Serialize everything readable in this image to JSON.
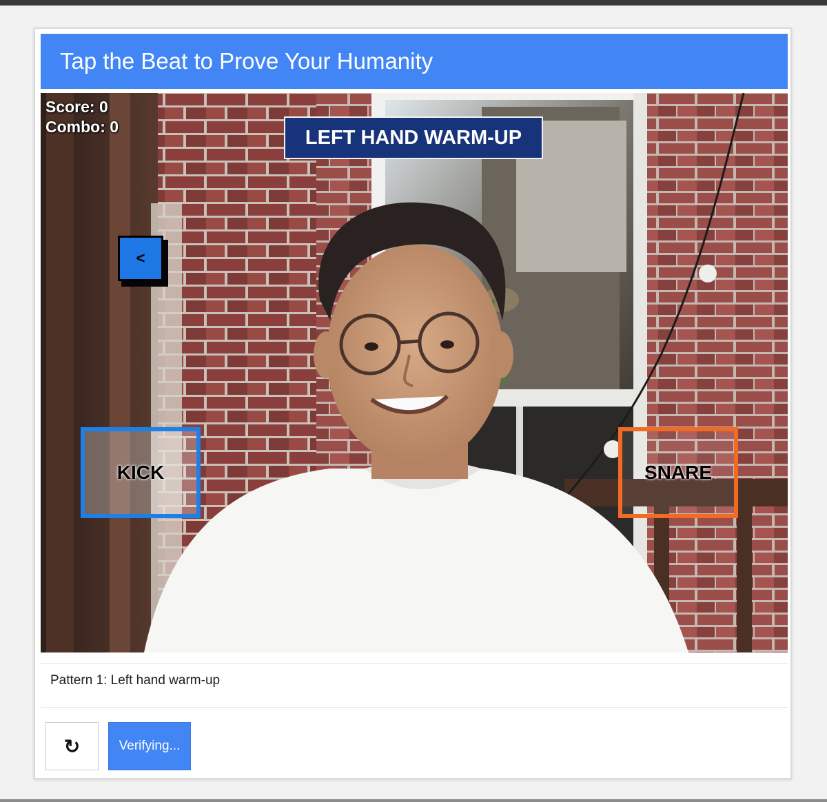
{
  "captcha": {
    "title": "Tap the Beat to Prove Your Humanity",
    "instructions": "Pattern 1: Left hand warm-up"
  },
  "game": {
    "score_text": "Score: 0",
    "combo_text": "Combo: 0",
    "pattern_name": "LEFT HAND WARM-UP",
    "incoming_note": "<",
    "pads": {
      "kick": "KICK",
      "snare": "SNARE"
    },
    "colors": {
      "kick": "#1d7fe8",
      "snare": "#f26b25",
      "note": "#1d78e6",
      "banner": "#17337a"
    }
  },
  "controls": {
    "reload_icon": "↻",
    "verify_label": "Verifying..."
  },
  "theme": {
    "accent": "#4285f4"
  }
}
